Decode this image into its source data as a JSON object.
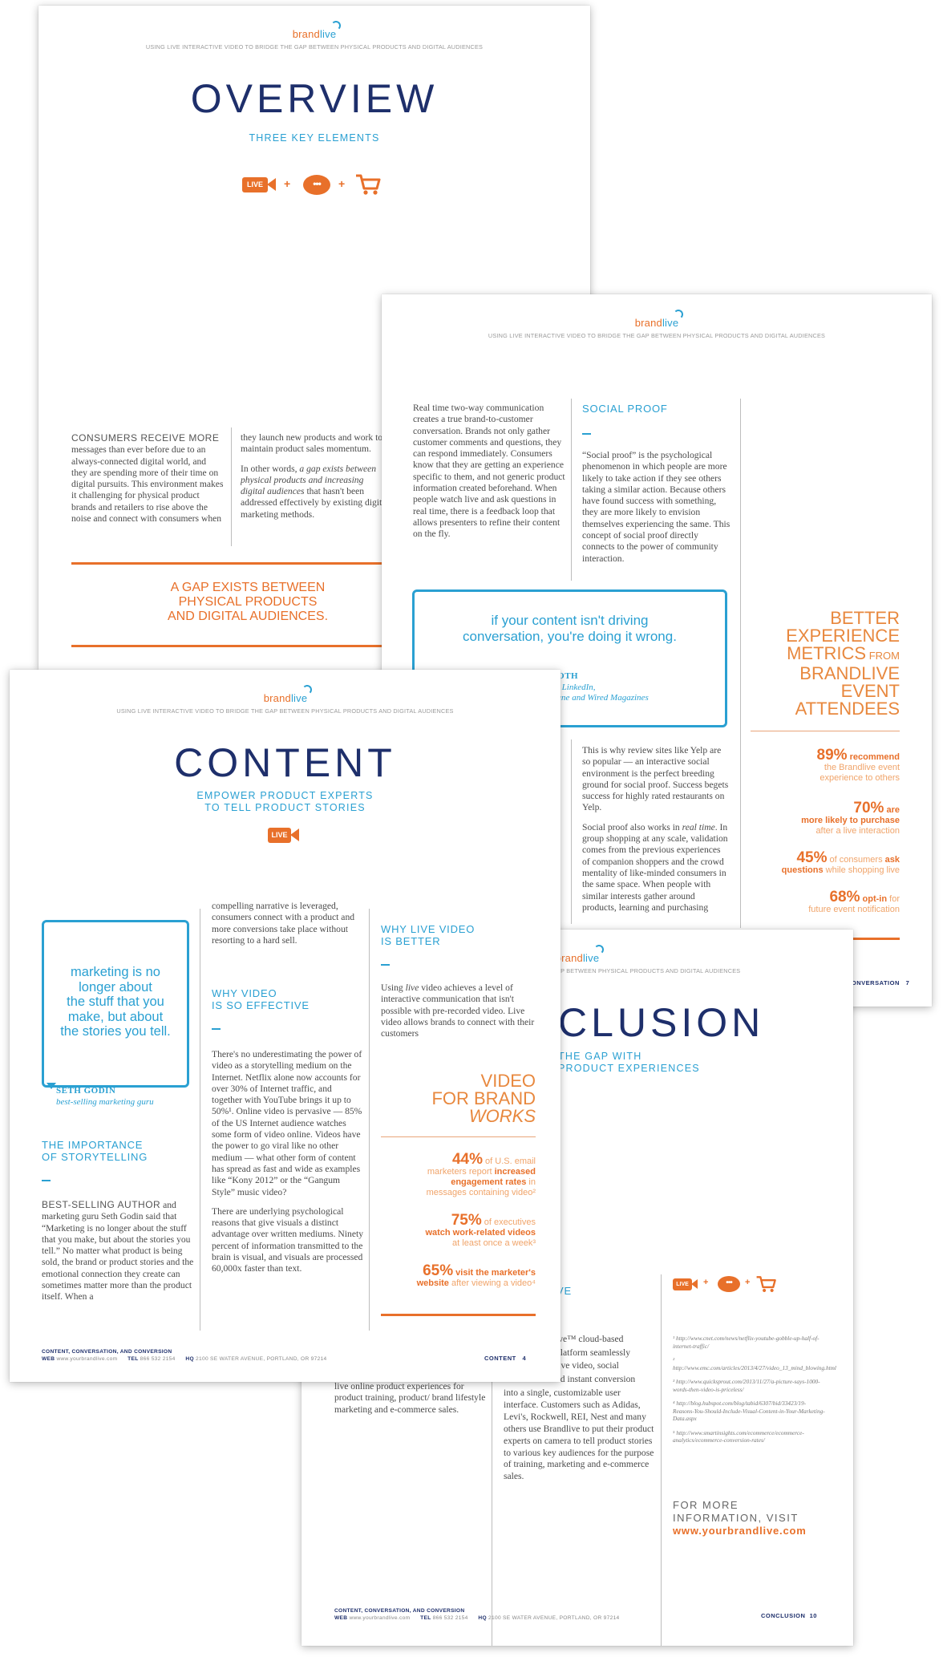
{
  "brand": {
    "part1": "brand",
    "part2": "live"
  },
  "tagline": "USING LIVE INTERACTIVE VIDEO TO BRIDGE THE GAP BETWEEN PHYSICAL PRODUCTS AND DIGITAL AUDIENCES",
  "icons": {
    "live_label": "LIVE",
    "plus": "+",
    "dots": "•••"
  },
  "overview": {
    "title": "OVERVIEW",
    "subtitle": "THREE KEY ELEMENTS",
    "col1_lead": "CONSUMERS RECEIVE MORE",
    "col1_text": "messages than ever before due to an always-connected digital world, and they are spending more of their time on digital pursuits. This environment makes it challenging for physical product brands and retailers to rise above the noise and connect with consumers when",
    "col2_p1": "they launch new products and work to maintain product sales momentum.",
    "col2_p2_a": "In other words, ",
    "col2_p2_em": "a gap exists between physical products and increasing digital audiences",
    "col2_p2_b": " that hasn't been addressed effectively by existing digital marketing methods.",
    "callout": [
      "A GAP EXISTS BETWEEN",
      "PHYSICAL PRODUCTS",
      "AND DIGITAL AUDIENCES."
    ]
  },
  "social": {
    "col1_text": "Real time two-way communication creates a true brand-to-customer conversation. Brands not only gather customer comments and questions, they can respond immediately. Consumers know that they are getting an experience specific to them, and not generic product information created beforehand. When people watch live and ask questions in real time, there is a feedback loop that allows presenters to refine their content on the fly.",
    "heading": "SOCIAL PROOF",
    "col2_text": "“Social proof” is the psychological phenomenon in which people are more likely to take action if they see others taking a similar action. Because others have found success with something, they are more likely to envision themselves experiencing the same. This concept of social proof directly connects to the power of community interaction.",
    "quote": [
      "if your content isn't driving",
      "conversation, you're doing it wrong."
    ],
    "quote_name": "N ROTH",
    "quote_role": [
      "ditor, LinkedIn,",
      "Fortune and Wired Magazines"
    ],
    "lower_p1": "This is why review sites like Yelp are so popular — an interactive social environment is the perfect breeding ground for social proof. Success begets success for highly rated restaurants on Yelp.",
    "lower_p2_a": "Social proof also works in ",
    "lower_p2_em": "real time",
    "lower_p2_b": ". In group shopping at any scale, validation comes from the previous experiences of companion shoppers and the crowd mentality of like-minded consumers in the same space. When people with similar interests gather around products, learning and purchasing",
    "metrics_title": {
      "l1": "BETTER",
      "l2": "EXPERIENCE",
      "l3a": "METRICS",
      "l3b": " FROM",
      "l4": "BRANDLIVE",
      "l5": "EVENT",
      "l6": "ATTENDEES"
    },
    "stats": [
      {
        "num": "89%",
        "em": " recommend",
        "rest": [
          "the Brandlive event",
          "experience to others"
        ]
      },
      {
        "num": "70%",
        "em": " are",
        "line2": "more likely to purchase",
        "rest": [
          "after a live interaction"
        ]
      },
      {
        "num": "45%",
        "plain": " of consumers ",
        "em": "ask",
        "line2a": "questions",
        "rest2": " while shopping live"
      },
      {
        "num": "68%",
        "em": " opt-in",
        "plain": " for",
        "rest": [
          "future event notification"
        ]
      }
    ],
    "page_label": "CONVERSATION",
    "page_num": "7"
  },
  "content": {
    "title": "CONTENT",
    "subtitle": [
      "EMPOWER PRODUCT EXPERTS",
      "TO TELL PRODUCT STORIES"
    ],
    "quote": [
      "marketing is no",
      "longer about",
      "the stuff that you",
      "make, but about",
      "the stories you tell."
    ],
    "quote_name": "SETH GODIN",
    "quote_role": "best-selling marketing guru",
    "story_heading": [
      "THE IMPORTANCE",
      "OF STORYTELLING"
    ],
    "story_lead": "BEST-SELLING AUTHOR",
    "story_text": " and marketing guru Seth Godin said that “Marketing is no longer about the stuff that you make, but about the stories you tell.” No matter what product is being sold, the brand or product stories and the emotional connection they create can sometimes matter more than the product itself. When a",
    "col2_top": "compelling narrative is leveraged, consumers connect with a product and more conversions take place without resorting to a hard sell.",
    "why_heading": [
      "WHY VIDEO",
      "IS SO EFFECTIVE"
    ],
    "why_p1": "There's no underestimating the power of video as a storytelling medium on the Internet. Netflix alone now accounts for over 30% of Internet traffic, and together with YouTube brings it up to 50%¹. Online video is pervasive — 85% of the US Internet audience watches some form of video online. Videos have the power to go viral like no other medium — what other form of content has spread as fast and wide as examples like “Kony 2012” or the “Gangum Style” music video?",
    "why_p2": "There are underlying psychological reasons that give visuals a distinct advantage over written mediums. Ninety percent of information transmitted to the brain is visual, and visuals are processed 60,000x faster than text.",
    "live_heading": [
      "WHY LIVE VIDEO",
      "IS BETTER"
    ],
    "live_a": "Using ",
    "live_em": "live",
    "live_b": " video achieves a level of interactive communication that isn't possible with pre-recorded video. Live video allows brands to connect with their customers",
    "works_title": {
      "l1": "VIDEO",
      "l2": "FOR BRAND",
      "l3": "WORKS"
    },
    "stats": [
      {
        "num": "44%",
        "a": " of U.S. email",
        "b": "marketers report ",
        "em1": "increased",
        "em2": "engagement rates",
        "c": " in",
        "d": "messages containing video²"
      },
      {
        "num": "75%",
        "a": " of executives",
        "em": "watch work-related videos",
        "d": "at least once a week³"
      },
      {
        "num": "65%",
        "em1": " visit the marketer's",
        "em2": "website",
        "d": " after viewing a video⁴"
      }
    ],
    "page_label": "CONTENT",
    "page_num": "4"
  },
  "conclusion": {
    "title_frag": "CLUSION",
    "tagline_frag": "AP BETWEEN PHYSICAL PRODUCTS AND DIGITAL AUDIENCES",
    "subtitle": [
      "THE GAP WITH",
      "PRODUCT EXPERIENCES"
    ],
    "heading_frag": "VE",
    "col1_text": "live online product experiences for product training, product/ brand lifestyle marketing and e-commerce sales.",
    "col2_text": "ive™ cloud-based platform seamlessly live video, social nd instant conversion into a single, customizable user interface. Customers such as Adidas, Levi's, Rockwell, REI, Nest and many others use Brandlive to put their product experts on camera to tell product stories to various key audiences for the purpose of training, marketing and e-commerce sales.",
    "col2_lines": [
      "ive™ cloud-based",
      "platform seamlessly",
      "live video, social",
      "nd instant conversion"
    ],
    "col2_rest": "into a single, customizable user interface. Customers such as Adidas, Levi's, Rockwell, REI, Nest and many others use Brandlive to put their product experts on camera to tell product stories to various key audiences for the purpose of training, marketing and e-commerce sales.",
    "footnotes": [
      "¹ http://www.cnet.com/news/netflix-youtube-gobble-up-half-of-internet-traffic/",
      "² http://www.emc.com/articles/2013/4/27/video_13_mind_blowing.html",
      "³ http://www.quicksprout.com/2013/11/27/a-picture-says-1000-words-then-video-is-priceless/",
      "⁴ http://blog.hubspot.com/blog/tabid/6307/bid/33423/19-Reasons-You-Should-Include-Visual-Content-in-Your-Marketing-Data.aspx",
      "⁵ http://www.smartinsights.com/ecommerce/ecommerce-analytics/ecommerce-conversion-rates/"
    ],
    "more": [
      "FOR MORE",
      "INFORMATION, VISIT"
    ],
    "url": "www.yourbrandlive.com",
    "page_label": "CONCLUSION",
    "page_num": "10"
  },
  "footer": {
    "title": "CONTENT, CONVERSATION, AND CONVERSION",
    "web_label": "WEB",
    "web": "www.yourbrandlive.com",
    "tel_label": "TEL",
    "tel": "866 532 2154",
    "hq_label": "HQ",
    "hq": "2100 SE WATER AVENUE, PORTLAND, OR 97214"
  }
}
